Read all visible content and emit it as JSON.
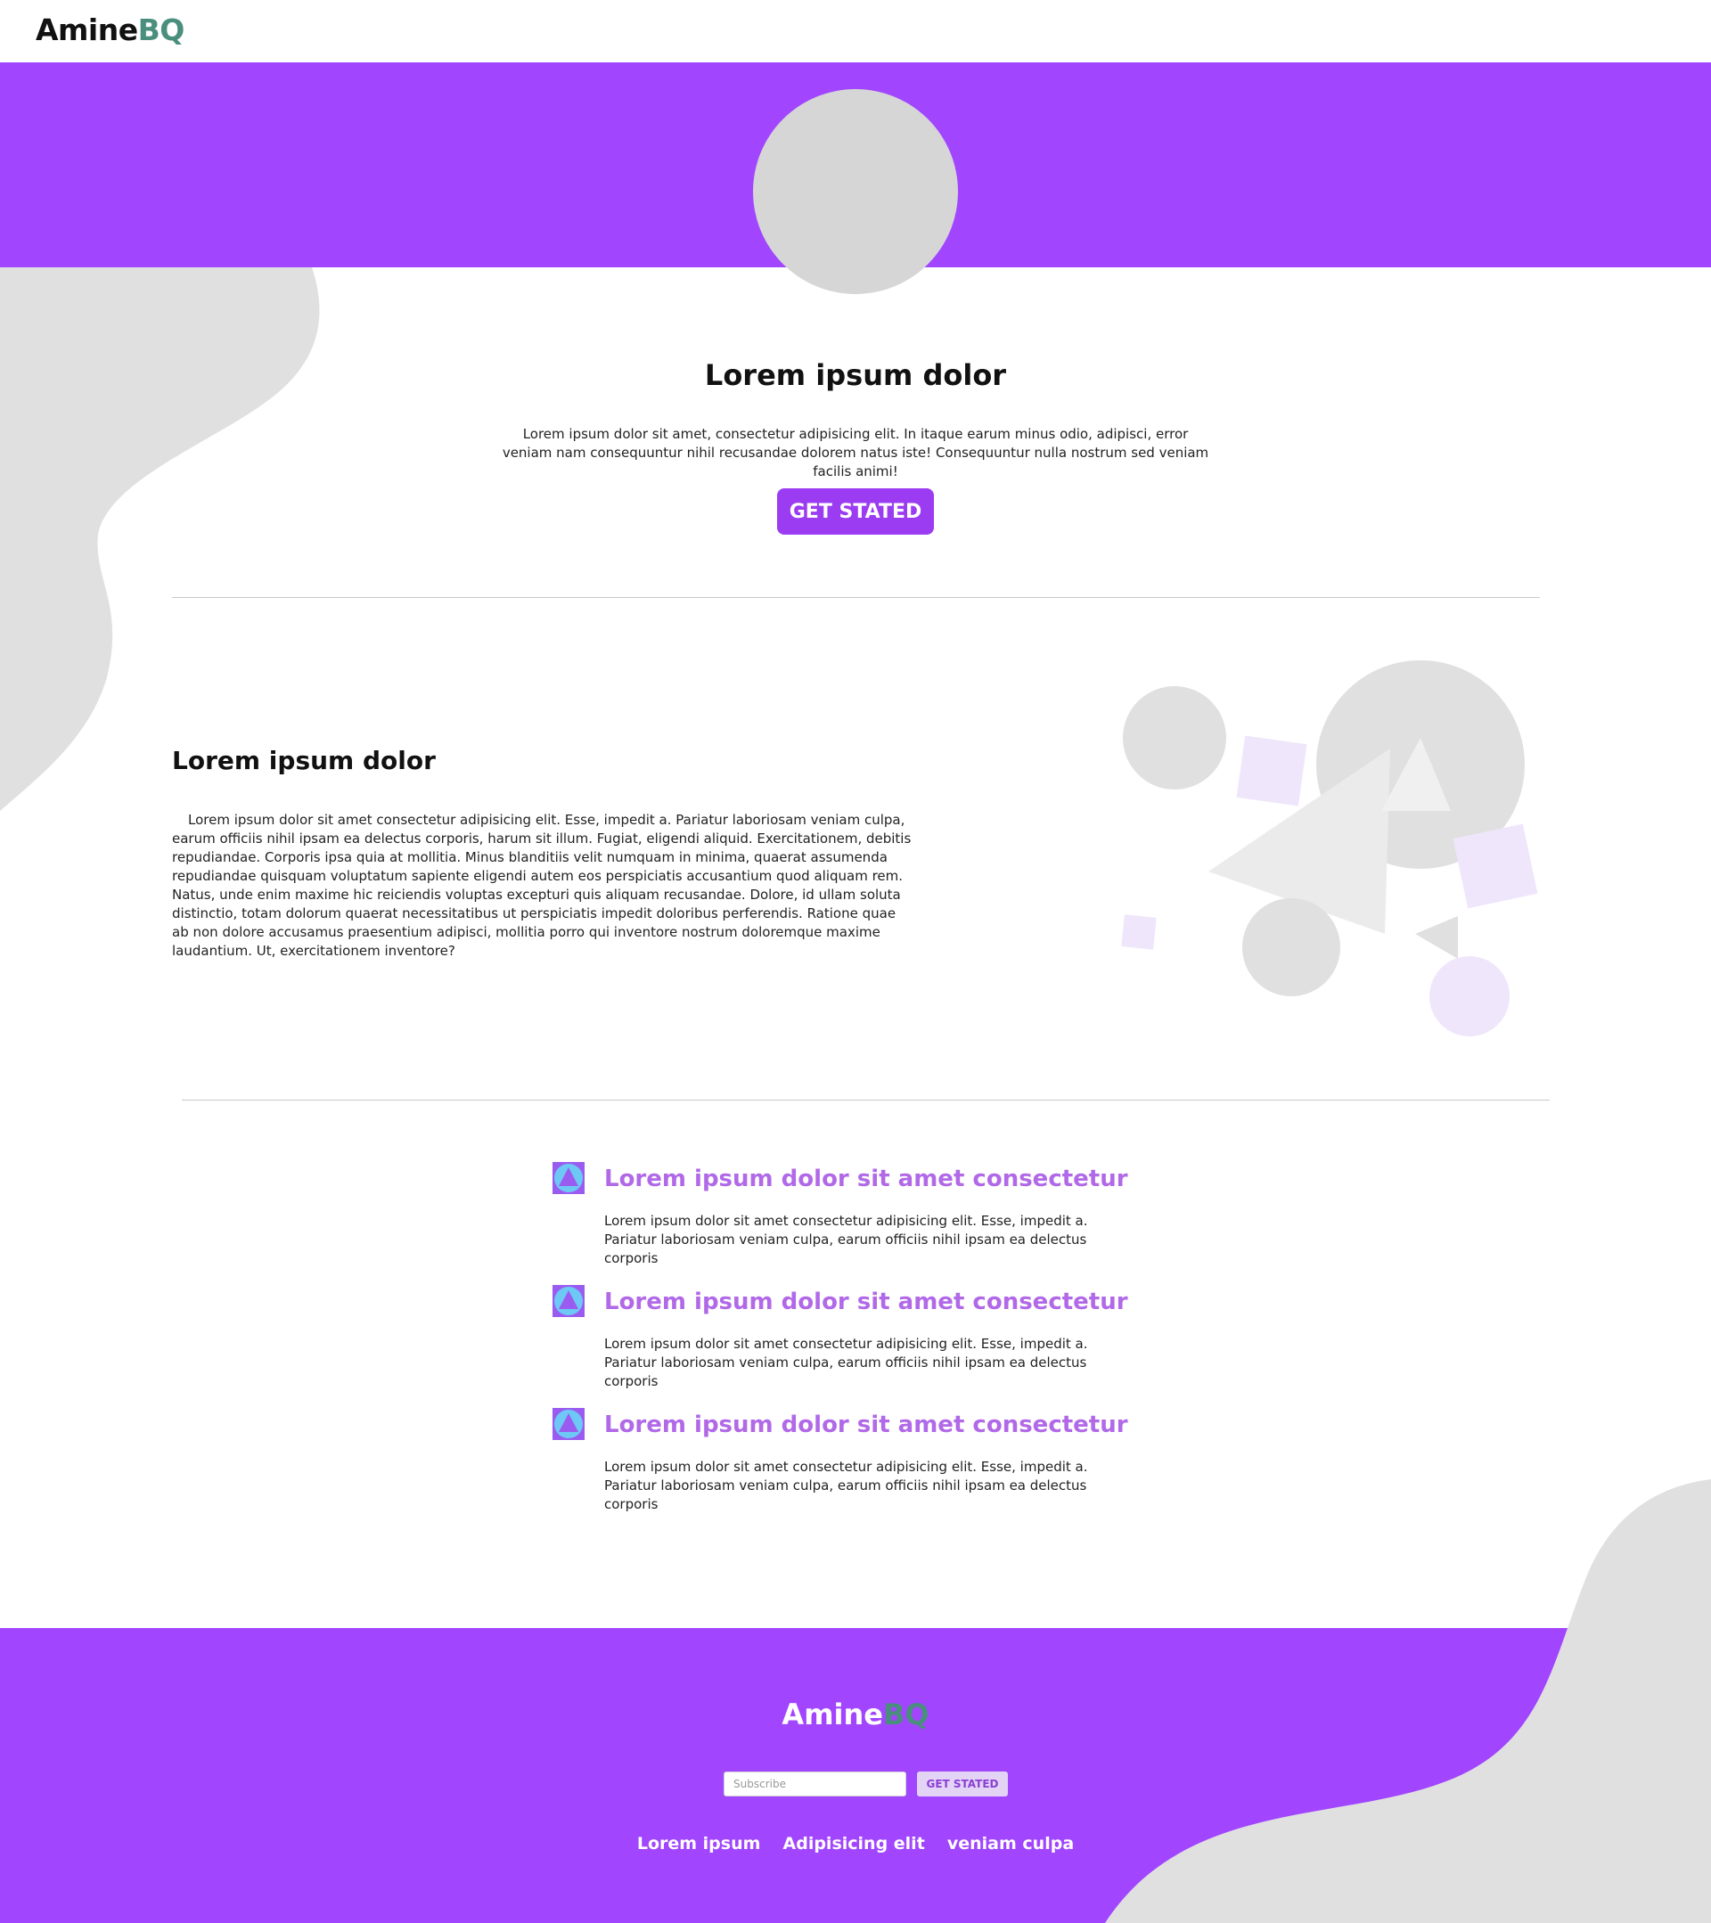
{
  "header": {
    "logo_part1": "Amine",
    "logo_part2": "BQ"
  },
  "hero": {
    "title": "Lorem ipsum dolor",
    "text": "Lorem ipsum dolor sit amet, consectetur adipisicing elit. In itaque earum minus odio, adipisci, error veniam nam consequuntur nihil recusandae dolorem natus iste! Consequuntur nulla nostrum sed veniam facilis animi!",
    "button_label": "GET STATED"
  },
  "about": {
    "title": "Lorem ipsum dolor",
    "text": "Lorem ipsum dolor sit amet consectetur adipisicing elit. Esse, impedit a. Pariatur laboriosam veniam culpa, earum officiis nihil ipsam ea delectus corporis, harum sit illum. Fugiat, eligendi aliquid. Exercitationem, debitis repudiandae. Corporis ipsa quia at mollitia. Minus blanditiis velit numquam in minima, quaerat assumenda repudiandae quisquam voluptatum sapiente eligendi autem eos perspiciatis accusantium quod aliquam rem. Natus, unde enim maxime hic reiciendis voluptas excepturi quis aliquam recusandae. Dolore, id ullam soluta distinctio, totam dolorum quaerat necessitatibus ut perspiciatis impedit doloribus perferendis. Ratione quae ab non dolore accusamus praesentium adipisci, mollitia porro qui inventore nostrum doloremque maxime laudantium. Ut, exercitationem inventore?"
  },
  "features": [
    {
      "icon": "triangle-icon",
      "title": "Lorem ipsum dolor sit amet consectetur",
      "text": "Lorem ipsum dolor sit amet consectetur adipisicing elit. Esse, impedit a. Pariatur laboriosam veniam culpa, earum officiis nihil ipsam ea delectus corporis"
    },
    {
      "icon": "triangle-icon",
      "title": "Lorem ipsum dolor sit amet consectetur",
      "text": "Lorem ipsum dolor sit amet consectetur adipisicing elit. Esse, impedit a. Pariatur laboriosam veniam culpa, earum officiis nihil ipsam ea delectus corporis"
    },
    {
      "icon": "triangle-icon",
      "title": "Lorem ipsum dolor sit amet consectetur",
      "text": "Lorem ipsum dolor sit amet consectetur adipisicing elit. Esse, impedit a. Pariatur laboriosam veniam culpa, earum officiis nihil ipsam ea delectus corporis"
    }
  ],
  "footer": {
    "logo_part1": "Amine",
    "logo_part2": "BQ",
    "subscribe_placeholder": "Subscribe",
    "subscribe_button": "GET STATED",
    "links": [
      "Lorem ipsum",
      "Adipisicing elit",
      "veniam culpa"
    ]
  },
  "colors": {
    "brand_purple": "#a145ff",
    "button_purple": "#9b3cf2",
    "feature_title": "#b169e8",
    "logo_accent": "#4a8f7e",
    "blob_gray": "#e0e0e0"
  }
}
